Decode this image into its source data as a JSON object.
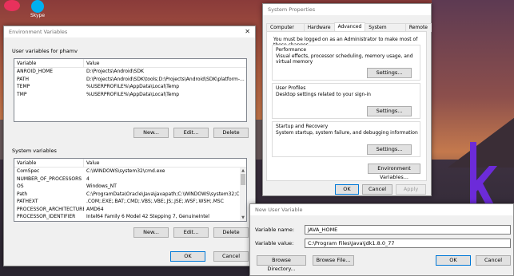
{
  "env_vars_dialog": {
    "title": "Environment Variables",
    "user_section_label": "User variables for phamv",
    "columns": [
      "Variable",
      "Value"
    ],
    "user_rows": [
      {
        "variable": "ANROID_HOME",
        "value": "D:\\Projects\\Android\\SDK"
      },
      {
        "variable": "PATH",
        "value": "D:\\Projects\\Android\\SDK\\tools;D:\\Projects\\Android\\SDK\\platform-..."
      },
      {
        "variable": "TEMP",
        "value": "%USERPROFILE%\\AppData\\Local\\Temp"
      },
      {
        "variable": "TMP",
        "value": "%USERPROFILE%\\AppData\\Local\\Temp"
      }
    ],
    "system_section_label": "System variables",
    "system_rows": [
      {
        "variable": "ComSpec",
        "value": "C:\\WINDOWS\\system32\\cmd.exe"
      },
      {
        "variable": "NUMBER_OF_PROCESSORS",
        "value": "4"
      },
      {
        "variable": "OS",
        "value": "Windows_NT"
      },
      {
        "variable": "Path",
        "value": "C:\\ProgramData\\Oracle\\Java\\javapath;C:\\WINDOWS\\system32;C:\\..."
      },
      {
        "variable": "PATHEXT",
        "value": ".COM;.EXE;.BAT;.CMD;.VBS;.VBE;.JS;.JSE;.WSF;.WSH;.MSC"
      },
      {
        "variable": "PROCESSOR_ARCHITECTURE",
        "value": "AMD64"
      },
      {
        "variable": "PROCESSOR_IDENTIFIER",
        "value": "Intel64 Family 6 Model 42 Stepping 7, GenuineIntel"
      }
    ],
    "new_label": "New...",
    "edit_label": "Edit...",
    "delete_label": "Delete",
    "ok_label": "OK",
    "cancel_label": "Cancel"
  },
  "sys_props": {
    "title": "System Properties",
    "tabs": [
      "Computer Name",
      "Hardware",
      "Advanced",
      "System Protection",
      "Remote"
    ],
    "admin_note": "You must be logged on as an Administrator to make most of these changes.",
    "performance_title": "Performance",
    "performance_desc": "Visual effects, processor scheduling, memory usage, and virtual memory",
    "user_profiles_title": "User Profiles",
    "user_profiles_desc": "Desktop settings related to your sign-in",
    "startup_title": "Startup and Recovery",
    "startup_desc": "System startup, system failure, and debugging information",
    "settings_label": "Settings...",
    "env_vars_button": "Environment Variables...",
    "ok_label": "OK",
    "cancel_label": "Cancel",
    "apply_label": "Apply"
  },
  "new_user_var": {
    "title": "New User Variable",
    "name_label": "Variable name:",
    "name_value": "JAVA_HOME",
    "value_label": "Variable value:",
    "value_value": "C:\\Program Files\\Java\\jdk1.8.0_77",
    "browse_dir_label": "Browse Directory...",
    "browse_file_label": "Browse File...",
    "ok_label": "OK",
    "cancel_label": "Cancel"
  },
  "desktop": {
    "icon_label": "Skype",
    "colors": {
      "accent": "#0078d7",
      "logo_purple": "#6c2bd9"
    }
  }
}
